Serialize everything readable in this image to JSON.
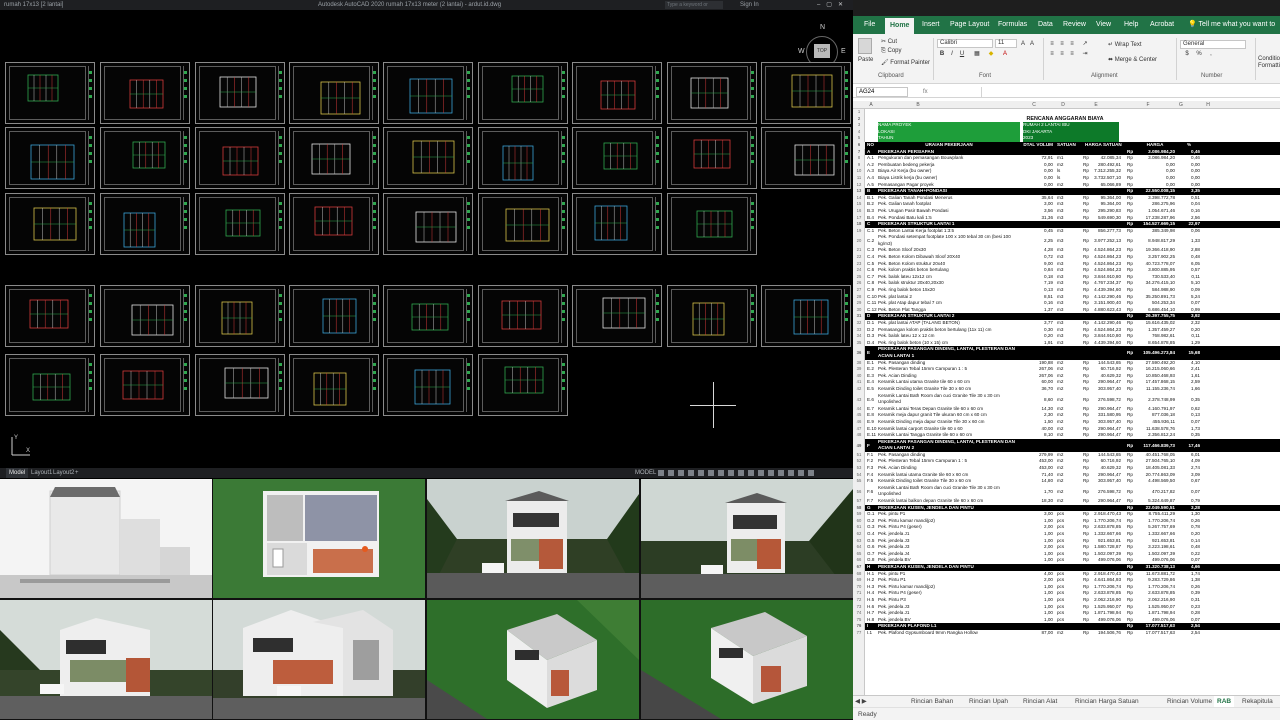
{
  "autocad": {
    "title_left": "rumah 17x13 [2 lantai]",
    "app_title": "Autodesk AutoCAD 2020   rumah 17x13 meter (2 lantai) - ardut.id.dwg",
    "search_placeholder": "Type a keyword or phrase",
    "signin": "Sign In",
    "viewcube": {
      "top": "TOP",
      "n": "N",
      "s": "S",
      "e": "E",
      "w": "W"
    },
    "ucs": {
      "y": "Y",
      "x": "X"
    },
    "layout_tabs": [
      "Model",
      "Layout1",
      "Layout2",
      "+"
    ],
    "status_model": "MODEL"
  },
  "excel": {
    "ribbon_tabs": [
      "File",
      "Home",
      "Insert",
      "Page Layout",
      "Formulas",
      "Data",
      "Review",
      "View",
      "Help",
      "Acrobat"
    ],
    "tell_me": "Tell me what you want to do",
    "clipboard": {
      "paste": "Paste",
      "cut": "Cut",
      "copy": "Copy",
      "format_painter": "Format Painter",
      "label": "Clipboard"
    },
    "font": {
      "name": "Calibri",
      "size": "11",
      "bold": "B",
      "italic": "I",
      "underline": "U",
      "label": "Font"
    },
    "alignment": {
      "wrap_text": "Wrap Text",
      "merge_center": "Merge & Center",
      "label": "Alignment"
    },
    "number": {
      "format": "General",
      "label": "Number"
    },
    "conditional": "Condition Formattin",
    "name_box": "AG24",
    "fx": "fx",
    "columns": [
      "A",
      "B",
      "C",
      "D",
      "E",
      "F",
      "G",
      "H"
    ],
    "title": "RENCANA ANGGARAN BIAYA",
    "project_info": [
      {
        "label": "NAMA PROYEK",
        "value": "RUMAH 2 LANTAI IBU"
      },
      {
        "label": "LOKASI",
        "value": "DKI JAKARTA"
      },
      {
        "label": "TAHUN",
        "value": "2023"
      }
    ],
    "table_header": {
      "no": "NO",
      "uraian": "URAIAN PEKERJAAN",
      "volume": "DTAL VOLUM",
      "satuan": "SATUAN",
      "harga_satuan": "HARGA SATUAN",
      "harga": "HARGA",
      "pct": "%"
    },
    "rows": [
      {
        "n": "7",
        "type": "sec",
        "a": "A",
        "b": "PEKERJAAN PERSIAPAN",
        "f": "Rp",
        "f2": "3.086.984,20",
        "g": "0,46"
      },
      {
        "n": "8",
        "a": "A.1",
        "b": "Pengukuran dan pemasangan Bouwplank",
        "c": "72,91",
        "d": "m1",
        "e": "Rp",
        "e2": "42.085,34",
        "f": "Rp",
        "f2": "3.086.984,20",
        "g": "0,46"
      },
      {
        "n": "9",
        "a": "A.2",
        "b": "Pembuatan bedeng pekerja",
        "c": "0,00",
        "d": "m2",
        "e": "Rp",
        "e2": "280.492,61",
        "f": "Rp",
        "f2": "0,00",
        "g": "0,00"
      },
      {
        "n": "10",
        "a": "A.3",
        "b": "Biaya Air Kerja (bu owner)",
        "c": "0,00",
        "d": "ls",
        "e": "Rp",
        "e2": "7.312.255,32",
        "f": "Rp",
        "f2": "0,00",
        "g": "0,00"
      },
      {
        "n": "11",
        "a": "A.4",
        "b": "Biaya Listrik kerja (bu owner)",
        "c": "0,00",
        "d": "ls",
        "e": "Rp",
        "e2": "3.732.507,10",
        "f": "Rp",
        "f2": "0,00",
        "g": "0,00"
      },
      {
        "n": "12",
        "a": "A.5",
        "b": "Pemasangan Pagar proyek",
        "c": "0,00",
        "d": "m2",
        "e": "Rp",
        "e2": "65.066,89",
        "f": "Rp",
        "f2": "0,00",
        "g": "0,00"
      },
      {
        "n": "13",
        "type": "sec",
        "a": "B",
        "b": "PEKERJAAN TANAH+PONDASI",
        "f": "Rp",
        "f2": "22.550.008,15",
        "g": "3,35"
      },
      {
        "n": "14",
        "a": "B.1",
        "b": "Pek. Galian Tanah Pondasi Menerus",
        "c": "35,64",
        "d": "m3",
        "e": "Rp",
        "e2": "95.364,00",
        "f": "Rp",
        "f2": "3.398.772,78",
        "g": "0,51"
      },
      {
        "n": "15",
        "a": "B.2",
        "b": "Pek. Galian tanah footplat",
        "c": "3,00",
        "d": "m3",
        "e": "Rp",
        "e2": "95.364,00",
        "f": "Rp",
        "f2": "286.275,96",
        "g": "0,04"
      },
      {
        "n": "16",
        "a": "B.3",
        "b": "Pek. Urugan Pasir Bawah Pondasi",
        "c": "3,56",
        "d": "m3",
        "e": "Rp",
        "e2": "295.290,83",
        "f": "Rp",
        "f2": "1.054.671,46",
        "g": "0,16"
      },
      {
        "n": "17",
        "a": "B.4",
        "b": "Pek. Pondasi Batu kali 1:5",
        "c": "31,36",
        "d": "m3",
        "e": "Rp",
        "e2": "549.690,30",
        "f": "Rp",
        "f2": "17.238.287,96",
        "g": "2,56"
      },
      {
        "n": "18",
        "type": "sec",
        "a": "C",
        "b": "PEKERJAAN STRUKTUR LANTAI 1",
        "f": "Rp",
        "f2": "154.527.669,15",
        "g": "22,97"
      },
      {
        "n": "19",
        "a": "C.1",
        "b": "Pek. Beton Lantai Kerja footplat 1:3:5",
        "c": "0,45",
        "d": "m3",
        "e": "Rp",
        "e2": "856.277,73",
        "f": "Rp",
        "f2": "385.349,98",
        "g": "0,06"
      },
      {
        "n": "20",
        "type": "tall",
        "a": "C.2",
        "b": "Pek. Pondasi setempat footplate 100 x 100 tebal 30 cm (besi 100 kg/m3)",
        "c": "2,25",
        "d": "m3",
        "e": "Rp",
        "e2": "3.977.252,13",
        "f": "Rp",
        "f2": "8.948.817,29",
        "g": "1,33"
      },
      {
        "n": "21",
        "a": "C.3",
        "b": "Pek. Beton Sloof 20x30",
        "c": "4,28",
        "d": "m3",
        "e": "Rp",
        "e2": "4.524.864,23",
        "f": "Rp",
        "f2": "19.366.418,90",
        "g": "2,88"
      },
      {
        "n": "22",
        "a": "C.4",
        "b": "Pek. Beton Kolom Dibawah Sloof 20X40",
        "c": "0,72",
        "d": "m3",
        "e": "Rp",
        "e2": "4.524.864,23",
        "f": "Rp",
        "f2": "3.257.902,25",
        "g": "0,48"
      },
      {
        "n": "23",
        "a": "C.5",
        "b": "Pek. Beton Kolom struktur 20x40",
        "c": "9,00",
        "d": "m3",
        "e": "Rp",
        "e2": "4.524.864,23",
        "f": "Rp",
        "f2": "40.723.778,07",
        "g": "6,05"
      },
      {
        "n": "24",
        "a": "C.6",
        "b": "Pek. kolom praktis beton bertulang",
        "c": "0,84",
        "d": "m3",
        "e": "Rp",
        "e2": "4.524.864,23",
        "f": "Rp",
        "f2": "3.800.885,95",
        "g": "0,57"
      },
      {
        "n": "25",
        "a": "C.7",
        "b": "Pek. balok lateu 12x12 cm",
        "c": "0,18",
        "d": "m3",
        "e": "Rp",
        "e2": "3.844.910,80",
        "f": "Rp",
        "f2": "730.533,40",
        "g": "0,11"
      },
      {
        "n": "26",
        "a": "C.8",
        "b": "Pek. balok struktur 20x40,20x30",
        "c": "7,19",
        "d": "m3",
        "e": "Rp",
        "e2": "4.767.234,37",
        "f": "Rp",
        "f2": "34.276.415,10",
        "g": "5,10"
      },
      {
        "n": "27",
        "a": "C.9",
        "b": "Pek. ring balok beton 15x20",
        "c": "0,13",
        "d": "m3",
        "e": "Rp",
        "e2": "4.439.394,60",
        "f": "Rp",
        "f2": "584.988,90",
        "g": "0,09"
      },
      {
        "n": "28",
        "a": "C.10",
        "b": "Pek. plat lantai 2",
        "c": "8,51",
        "d": "m3",
        "e": "Rp",
        "e2": "4.142.290,46",
        "f": "Rp",
        "f2": "35.250.891,73",
        "g": "5,24"
      },
      {
        "n": "29",
        "a": "C.11",
        "b": "Pek. plat Atap dapur tebal 7 cm",
        "c": "0,16",
        "d": "m3",
        "e": "Rp",
        "e2": "3.151.900,40",
        "f": "Rp",
        "f2": "504.253,34",
        "g": "0,07"
      },
      {
        "n": "30",
        "a": "C.12",
        "b": "Pek. Beton Plat Tangga",
        "c": "1,37",
        "d": "m3",
        "e": "Rp",
        "e2": "4.880.623,43",
        "f": "Rp",
        "f2": "6.686.454,10",
        "g": "0,99"
      },
      {
        "n": "31",
        "type": "sec",
        "a": "D",
        "b": "PEKERJAAN STRUKTUR LANTAI 2",
        "f": "Rp",
        "f2": "26.397.755,75",
        "g": "3,92"
      },
      {
        "n": "32",
        "a": "D.1",
        "b": "Pek. plat lantai ATAP (TALANG BETON)",
        "c": "3,77",
        "d": "m3",
        "e": "Rp",
        "e2": "4.142.290,46",
        "f": "Rp",
        "f2": "15.616.435,02",
        "g": "2,32"
      },
      {
        "n": "33",
        "a": "D.2",
        "b": "Pemasangan kolom praktis beton bertulang (11x 11) cm",
        "c": "0,30",
        "d": "m3",
        "e": "Rp",
        "e2": "4.524.864,23",
        "f": "Rp",
        "f2": "1.357.459,27",
        "g": "0,20"
      },
      {
        "n": "34",
        "a": "D.3",
        "b": "Pek. balok lateu 12 x 12 cm",
        "c": "0,20",
        "d": "m3",
        "e": "Rp",
        "e2": "3.844.910,80",
        "f": "Rp",
        "f2": "768.982,61",
        "g": "0,11"
      },
      {
        "n": "35",
        "a": "D.4",
        "b": "Pek. ring balok beton (10 x 15) cm",
        "c": "1,91",
        "d": "m3",
        "e": "Rp",
        "e2": "4.439.394,60",
        "f": "Rp",
        "f2": "8.654.878,85",
        "g": "1,29"
      },
      {
        "n": "36",
        "type": "sec tall",
        "a": "E",
        "b": "PEKERJAAN PASANGAN DINDING, LANTAI, PLESTERAN DAN ACIAN LANTAI 1",
        "f": "Rp",
        "f2": "105.496.273,84",
        "g": "15,68"
      },
      {
        "n": "38",
        "a": "E.1",
        "b": "Pek. Pasangan dinding",
        "c": "190,88",
        "d": "m2",
        "e": "Rp",
        "e2": "144.543,65",
        "f": "Rp",
        "f2": "27.590.492,20",
        "g": "4,10"
      },
      {
        "n": "39",
        "a": "E.2",
        "b": "Pek. Plesteran Tebal 15mm Campuran 1 : 5",
        "c": "267,06",
        "d": "m2",
        "e": "Rp",
        "e2": "60.716,92",
        "f": "Rp",
        "f2": "16.215.060,66",
        "g": "2,41"
      },
      {
        "n": "40",
        "a": "E.3",
        "b": "Pek. Acian Dinding",
        "c": "267,06",
        "d": "m2",
        "e": "Rp",
        "e2": "40.629,32",
        "f": "Rp",
        "f2": "10.850.468,93",
        "g": "1,61"
      },
      {
        "n": "41",
        "a": "E.4",
        "b": "Keramik Lantai utama Granite tile 60 x 60 cm",
        "c": "60,00",
        "d": "m2",
        "e": "Rp",
        "e2": "290.964,47",
        "f": "Rp",
        "f2": "17.457.868,15",
        "g": "2,59"
      },
      {
        "n": "42",
        "a": "E.5",
        "b": "Keramik Dinding toilet Granite Tile 30 x 60 cm",
        "c": "36,70",
        "d": "m2",
        "e": "Rp",
        "e2": "303.957,40",
        "f": "Rp",
        "f2": "11.155.236,74",
        "g": "1,66"
      },
      {
        "n": "43",
        "type": "tall",
        "a": "E.6",
        "b": "Keramik Lantai Bath Room dan cuci Granite Tile 30 x 30 cm Unpolished",
        "c": "8,60",
        "d": "m2",
        "e": "Rp",
        "e2": "276.598,72",
        "f": "Rp",
        "f2": "2.378.748,99",
        "g": "0,35"
      },
      {
        "n": "44",
        "a": "E.7",
        "b": "Keramik Lantai Teras Depan Granite tile 60 x 60 cm",
        "c": "14,30",
        "d": "m2",
        "e": "Rp",
        "e2": "290.964,47",
        "f": "Rp",
        "f2": "4.160.791,97",
        "g": "0,62"
      },
      {
        "n": "45",
        "a": "E.8",
        "b": "Keramik meja dapur granit Tile ukuran 60 cm x 60 cm",
        "c": "2,30",
        "d": "m2",
        "e": "Rp",
        "e2": "331.580,95",
        "f": "Rp",
        "f2": "877.036,18",
        "g": "0,13"
      },
      {
        "n": "46",
        "a": "E.9",
        "b": "Keramik Dinding meja dapur Granite Tile 30 x 60 cm",
        "c": "1,50",
        "d": "m2",
        "e": "Rp",
        "e2": "303.957,40",
        "f": "Rp",
        "f2": "455.936,11",
        "g": "0,07"
      },
      {
        "n": "47",
        "a": "E.10",
        "b": "Keramik lantai carport Granite tile 60 x 60",
        "c": "40,00",
        "d": "m2",
        "e": "Rp",
        "e2": "290.964,47",
        "f": "Rp",
        "f2": "11.638.578,76",
        "g": "1,73"
      },
      {
        "n": "48",
        "a": "E.11",
        "b": "Keramik Lantai Tangga Granite tile 60 x 60 cm",
        "c": "8,10",
        "d": "m2",
        "e": "Rp",
        "e2": "290.964,47",
        "f": "Rp",
        "f2": "2.356.812,24",
        "g": "0,35"
      },
      {
        "n": "49",
        "type": "sec tall",
        "a": "F",
        "b": "PEKERJAAN PASANGAN DINDING, LANTAI, PLESTERAN DAN ACIAN LANTAI 2",
        "f": "Rp",
        "f2": "117.466.839,73",
        "g": "17,46"
      },
      {
        "n": "51",
        "a": "F.1",
        "b": "Pek. Pasangan dinding",
        "c": "279,99",
        "d": "m2",
        "e": "Rp",
        "e2": "144.543,65",
        "f": "Rp",
        "f2": "40.451.768,05",
        "g": "6,01"
      },
      {
        "n": "52",
        "a": "F.2",
        "b": "Pek. Plesteran Tebal 15mm Campuran 1 : 5",
        "c": "453,00",
        "d": "m2",
        "e": "Rp",
        "e2": "60.716,92",
        "f": "Rp",
        "f2": "27.504.765,10",
        "g": "4,09"
      },
      {
        "n": "53",
        "a": "F.3",
        "b": "Pek. Acian Dinding",
        "c": "453,00",
        "d": "m2",
        "e": "Rp",
        "e2": "40.629,32",
        "f": "Rp",
        "f2": "18.405.081,33",
        "g": "2,74"
      },
      {
        "n": "54",
        "a": "F.4",
        "b": "Keramik lantai utama Granite tile 60 x 60 cm",
        "c": "71,40",
        "d": "m2",
        "e": "Rp",
        "e2": "290.964,47",
        "f": "Rp",
        "f2": "20.774.863,09",
        "g": "3,09"
      },
      {
        "n": "55",
        "a": "F.5",
        "b": "Keramik Dinding toilet Granite Tile 30 x 60 cm",
        "c": "14,80",
        "d": "m2",
        "e": "Rp",
        "e2": "303.957,40",
        "f": "Rp",
        "f2": "4.498.569,50",
        "g": "0,67"
      },
      {
        "n": "56",
        "type": "tall",
        "a": "F.6",
        "b": "Keramik Lantai Bath Room dan cuci Granite Tile 30 x 30 cm Unpolished",
        "c": "1,70",
        "d": "m2",
        "e": "Rp",
        "e2": "276.598,72",
        "f": "Rp",
        "f2": "470.217,82",
        "g": "0,07"
      },
      {
        "n": "57",
        "a": "F.7",
        "b": "Keramik lantai balkon depan Granite tile 60 x 60 cm",
        "c": "18,30",
        "d": "m2",
        "e": "Rp",
        "e2": "290.964,47",
        "f": "Rp",
        "f2": "5.324.649,87",
        "g": "0,79"
      },
      {
        "n": "58",
        "type": "sec",
        "a": "G",
        "b": "PEKERJAAN KUSEN, JENDELA DAN PINTU",
        "f": "Rp",
        "f2": "22.049.590,51",
        "g": "3,28"
      },
      {
        "n": "59",
        "a": "G.1",
        "b": "Pek. pintu P1",
        "c": "3,00",
        "d": "pcs",
        "e": "Rp",
        "e2": "2.918.470,43",
        "f": "Rp",
        "f2": "8.755.411,29",
        "g": "1,30"
      },
      {
        "n": "60",
        "a": "G.2",
        "b": "Pek. Pintu kamar mandi(p2)",
        "c": "1,00",
        "d": "pcs",
        "e": "Rp",
        "e2": "1.770.206,74",
        "f": "Rp",
        "f2": "1.770.206,74",
        "g": "0,26"
      },
      {
        "n": "61",
        "a": "G.3",
        "b": "Pek. Pintu P4 (geser)",
        "c": "2,00",
        "d": "pcs",
        "e": "Rp",
        "e2": "2.633.878,85",
        "f": "Rp",
        "f2": "5.267.757,69",
        "g": "0,78"
      },
      {
        "n": "62",
        "a": "G.4",
        "b": "Pek. jendela J1",
        "c": "1,00",
        "d": "pcs",
        "e": "Rp",
        "e2": "1.332.667,66",
        "f": "Rp",
        "f2": "1.332.667,66",
        "g": "0,20"
      },
      {
        "n": "63",
        "a": "G.5",
        "b": "Pek. jendela J3",
        "c": "1,00",
        "d": "pcs",
        "e": "Rp",
        "e2": "921.653,81",
        "f": "Rp",
        "f2": "921.653,81",
        "g": "0,14"
      },
      {
        "n": "64",
        "a": "G.6",
        "b": "Pek. jendela J3",
        "c": "2,00",
        "d": "pcs",
        "e": "Rp",
        "e2": "1.580.728,87",
        "f": "Rp",
        "f2": "3.223.198,61",
        "g": "0,48"
      },
      {
        "n": "65",
        "a": "G.7",
        "b": "Pek. jendela J4",
        "c": "1,00",
        "d": "pcs",
        "e": "Rp",
        "e2": "1.502.097,39",
        "f": "Rp",
        "f2": "1.502.097,39",
        "g": "0,22"
      },
      {
        "n": "66",
        "a": "G.8",
        "b": "Pek. jendela BV",
        "c": "1,00",
        "d": "pcs",
        "e": "Rp",
        "e2": "499.076,06",
        "f": "Rp",
        "f2": "499.076,06",
        "g": "0,07"
      },
      {
        "n": "67",
        "type": "sec",
        "a": "H",
        "b": "PEKERJAAN KUSEN, JENDELA DAN PINTU",
        "f": "Rp",
        "f2": "31.320.738,13",
        "g": "4,66"
      },
      {
        "n": "68",
        "a": "H.1",
        "b": "Pek. pintu P1",
        "c": "4,00",
        "d": "pcs",
        "e": "Rp",
        "e2": "2.918.470,43",
        "f": "Rp",
        "f2": "11.673.881,72",
        "g": "1,74"
      },
      {
        "n": "69",
        "a": "H.2",
        "b": "Pek. Pintu P1",
        "c": "2,00",
        "d": "pcs",
        "e": "Rp",
        "e2": "4.641.864,93",
        "f": "Rp",
        "f2": "9.283.729,86",
        "g": "1,38"
      },
      {
        "n": "70",
        "a": "H.3",
        "b": "Pek. Pintu kamar mandi(p2)",
        "c": "1,00",
        "d": "pcs",
        "e": "Rp",
        "e2": "1.770.206,74",
        "f": "Rp",
        "f2": "1.770.206,74",
        "g": "0,26"
      },
      {
        "n": "71",
        "a": "H.4",
        "b": "Pek. Pintu P4 (geser)",
        "c": "1,00",
        "d": "pcs",
        "e": "Rp",
        "e2": "2.633.878,85",
        "f": "Rp",
        "f2": "2.633.878,85",
        "g": "0,39"
      },
      {
        "n": "72",
        "a": "H.5",
        "b": "Pek. Pintu P3",
        "c": "1,00",
        "d": "pcs",
        "e": "Rp",
        "e2": "2.062.216,90",
        "f": "Rp",
        "f2": "2.062.216,90",
        "g": "0,31"
      },
      {
        "n": "73",
        "a": "H.6",
        "b": "Pek. jendela J3",
        "c": "1,00",
        "d": "pcs",
        "e": "Rp",
        "e2": "1.525.950,07",
        "f": "Rp",
        "f2": "1.525.950,07",
        "g": "0,23"
      },
      {
        "n": "74",
        "a": "H.7",
        "b": "Pek. jendela J1",
        "c": "1,00",
        "d": "pcs",
        "e": "Rp",
        "e2": "1.871.798,94",
        "f": "Rp",
        "f2": "1.871.798,94",
        "g": "0,28"
      },
      {
        "n": "75",
        "a": "H.8",
        "b": "Pek. jendela BV",
        "c": "1,00",
        "d": "pcs",
        "e": "Rp",
        "e2": "499.076,06",
        "f": "Rp",
        "f2": "499.076,06",
        "g": "0,07"
      },
      {
        "n": "76",
        "type": "sec",
        "a": "I",
        "b": "PEKERJAAN PLAFOND L1",
        "f": "Rp",
        "f2": "17.077.517,63",
        "g": "2,54"
      },
      {
        "n": "77",
        "a": "I.1",
        "b": "Pek. Plafond Gypsumboard 9mm Rangka Hollow",
        "c": "87,00",
        "d": "m2",
        "e": "Rp",
        "e2": "194.506,76",
        "f": "Rp",
        "f2": "17.077.517,63",
        "g": "2,54"
      }
    ],
    "sheet_tabs": [
      "Rincian Bahan",
      "Rincian Upah",
      "Rincian Alat",
      "Rincian Harga Satuan",
      "Rincian Volume",
      "RAB",
      "Rekapitula"
    ],
    "active_sheet": "RAB",
    "status": "Ready"
  }
}
